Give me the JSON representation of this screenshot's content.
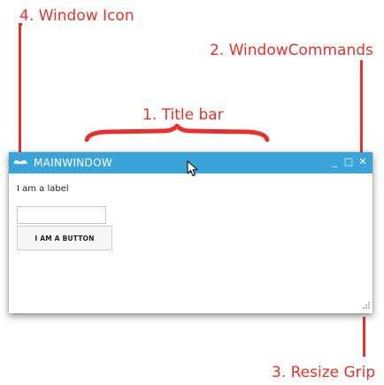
{
  "callouts": {
    "window_icon": "4. Window Icon",
    "window_commands": "2. WindowCommands",
    "title_bar": "1. Title bar",
    "resize_grip": "3. Resize Grip"
  },
  "window": {
    "title": "MAINWINDOW",
    "commands": {
      "minimize": "_",
      "maximize": "□",
      "close": "✕"
    },
    "label_text": "I am a label",
    "textbox_value": "",
    "button_label": "I AM A BUTTON"
  },
  "colors": {
    "annotation": "#e8312a",
    "title_bar": "#3aa3d8",
    "window_background": "#ffffff"
  },
  "icons": {
    "window_icon": "mustache-icon",
    "grip": "resize-grip-icon",
    "cursor": "mouse-pointer-icon"
  }
}
